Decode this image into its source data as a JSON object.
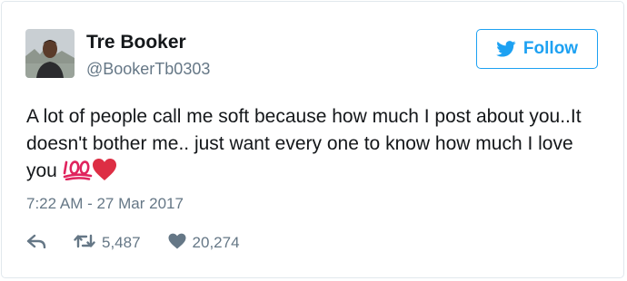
{
  "user": {
    "name": "Tre Booker",
    "handle": "@BookerTb0303"
  },
  "follow_button": {
    "label": "Follow"
  },
  "tweet": {
    "text": "A lot of people call me soft because how much I post about you..It doesn't bother me.. just want every one to know how much I love you",
    "emojis": [
      "hundred-points-icon",
      "red-heart-icon"
    ],
    "timestamp": "7:22 AM - 27 Mar 2017"
  },
  "stats": {
    "retweets": "5,487",
    "likes": "20,274"
  },
  "colors": {
    "accent": "#1da1f2",
    "muted": "#657786",
    "text": "#14171a",
    "heart": "#e0245e"
  }
}
